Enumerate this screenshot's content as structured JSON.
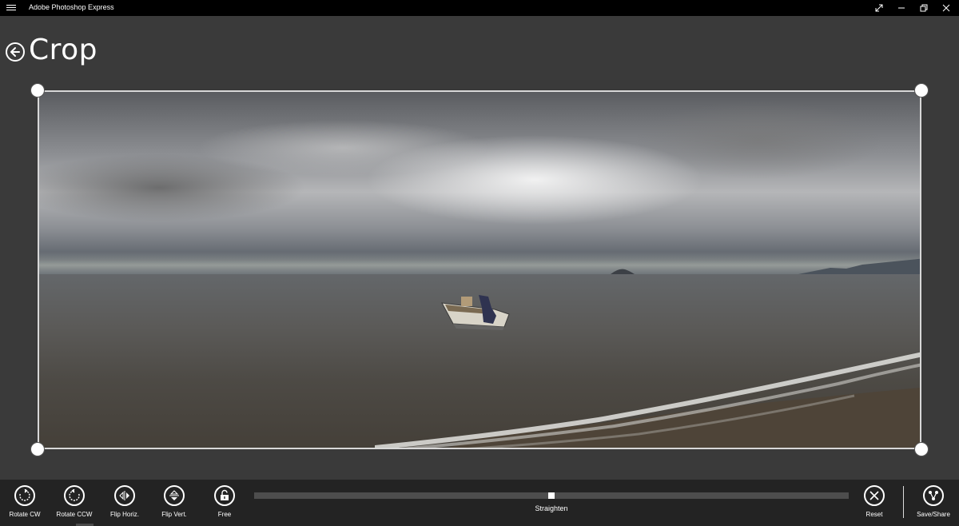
{
  "window": {
    "app_title": "Adobe Photoshop Express",
    "controls": [
      "fullscreen-icon",
      "minimize-icon",
      "restore-icon",
      "close-icon"
    ]
  },
  "header": {
    "title": "Crop",
    "back_icon": "back-arrow-icon"
  },
  "image": {
    "description_icon": "photo"
  },
  "toolbar": {
    "tools": [
      {
        "label": "Rotate CW",
        "icon": "rotate-cw-icon"
      },
      {
        "label": "Rotate CCW",
        "icon": "rotate-ccw-icon"
      },
      {
        "label": "Flip Horiz.",
        "icon": "flip-horizontal-icon"
      },
      {
        "label": "Flip Vert.",
        "icon": "flip-vertical-icon"
      },
      {
        "label": "Free",
        "icon": "unlock-icon"
      }
    ],
    "straighten": {
      "label": "Straighten",
      "value_fraction": 0.5
    },
    "reset_label": "Reset",
    "save_share_label": "Save/Share"
  },
  "colors": {
    "background": "#3a3a3a",
    "titlebar": "#000000",
    "toolbar": "#232323",
    "accent": "#ffffff"
  }
}
